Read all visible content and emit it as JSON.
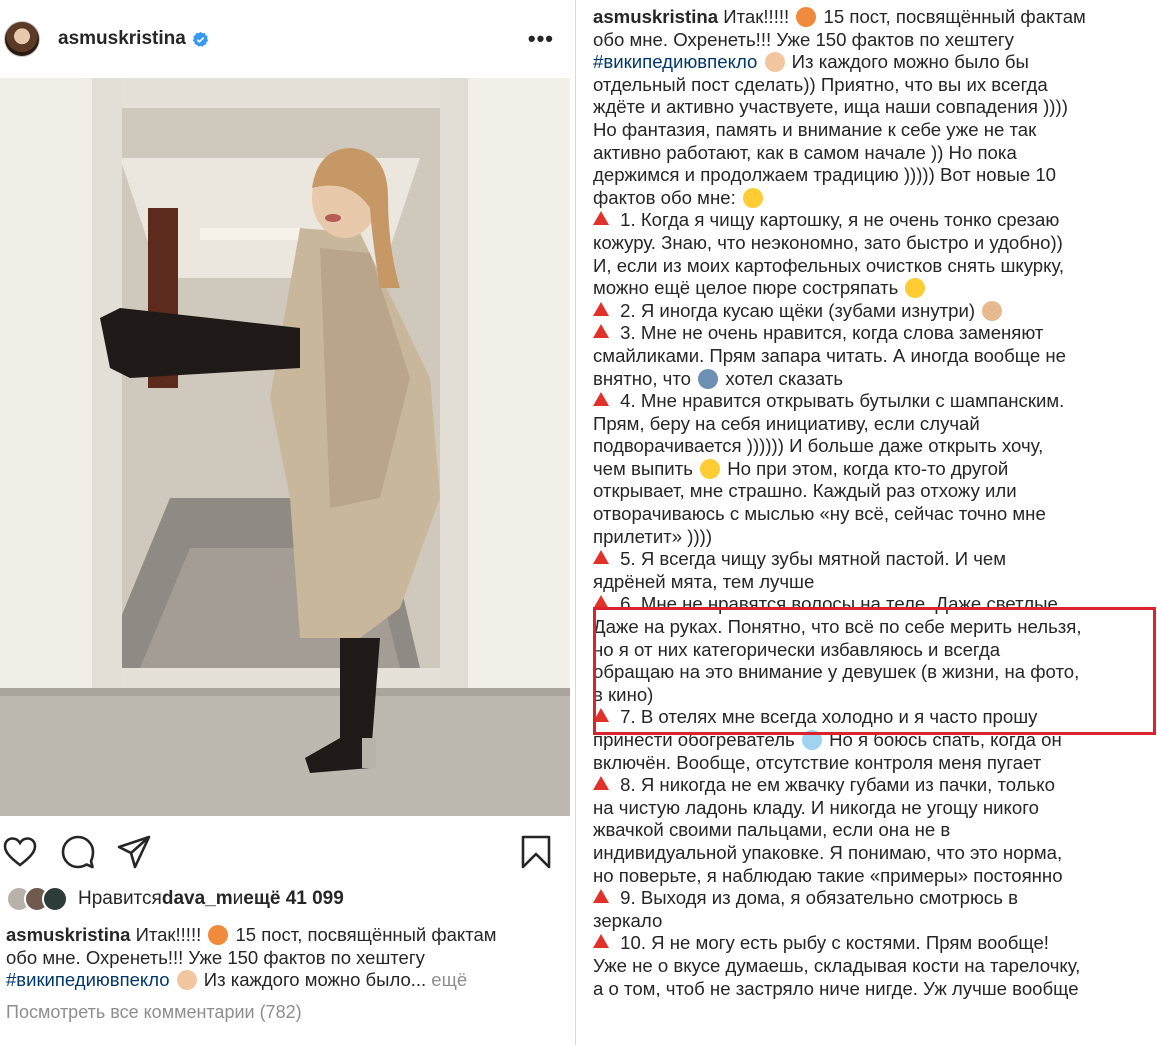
{
  "post": {
    "username": "asmuskristina",
    "more_label": "•••",
    "likes": {
      "prefix": "Нравится ",
      "user": "dava_m",
      "middle": " и ",
      "count": "ещё 41 099"
    },
    "caption_preview": {
      "username": "asmuskristina",
      "line1": " Итак!!!!! ",
      "line1b": " 15 пост, посвящённый фактам",
      "line2": "обо мне. Охренеть!!! Уже 150 фактов по хештегу",
      "hashtag": "#википедиювпекло",
      "line3": " Из каждого можно было...",
      "more": " ещё"
    },
    "view_comments": "Посмотреть все комментарии (782)"
  },
  "caption_full": {
    "username": "asmuskristina",
    "lines": [
      " Итак!!!!! [E1] 15 пост, посвящённый фактам",
      "обо мне. Охренеть!!! Уже 150 фактов по хештегу",
      "#википедиювпекло [E2] Из каждого можно было бы",
      "отдельный пост сделать)) Приятно, что вы их всегда",
      "ждёте и активно участвуете, ища наши совпадения ))))",
      "Но фантазия, память и внимание к себе уже не так",
      "активно работают, как в самом начале )) Но пока",
      "держимся и продолжаем традицию ))))) Вот новые 10",
      "фактов обо мне: [E3]",
      "[T] 1. Когда я чищу картошку, я не очень тонко срезаю",
      "кожуру. Знаю, что неэкономно, зато быстро и удобно))",
      "И, если из моих картофельных очистков снять шкурку,",
      "можно ещё целое пюре состряпать [E4]",
      "[T] 2. Я иногда кусаю щёки (зубами изнутри) [E5]",
      "[T] 3. Мне не очень нравится, когда слова заменяют",
      "смайликами. Прям запара читать. А иногда вообще не",
      "внятно, что [E6] хотел сказать",
      "[T] 4. Мне нравится открывать бутылки с шампанским.",
      "Прям, беру на себя инициативу, если случай",
      "подворачивается )))))) И больше даже открыть хочу,",
      "чем выпить [E4] Но при этом, когда кто-то другой",
      "открывает, мне страшно. Каждый раз отхожу или",
      "отворачиваюсь с мыслью «ну всё, сейчас точно мне",
      "прилетит» ))))",
      "[T] 5. Я всегда чищу зубы мятной пастой. И чем",
      "ядрёней мята, тем лучше",
      "[T] 6. Мне не нравятся волосы на теле. Даже светлые.",
      "Даже на руках. Понятно, что всё по себе мерить нельзя,",
      "но я от них категорически избавляюсь и всегда",
      "обращаю на это внимание у девушек (в жизни, на фото,",
      "в кино)",
      "[T] 7. В отелях мне всегда холодно и я часто прошу",
      "принести обогреватель [E7] Но я боюсь спать, когда он",
      "включён. Вообще, отсутствие контроля меня пугает",
      "[T] 8. Я никогда не ем жвачку губами из пачки, только",
      "на чистую ладонь кладу. И никогда не угощу никого",
      "жвачкой своими пальцами, если она не в",
      "индивидуальной упаковке. Я понимаю, что это норма,",
      "но поверьте, я наблюдаю такие «примеры» постоянно",
      "[T] 9. Выходя из дома, я обязательно смотрюсь в",
      "зеркало",
      "[T] 10. Я не могу есть рыбу с костями. Прям вообще!",
      "Уже не о вкусе думаешь, складывая кости на тарелочку,",
      "а о том, чтоб не застряло ниче нигде. Уж лучше вообще"
    ]
  },
  "emoji_colors": {
    "E1": "#f08a3c",
    "E2": "#f2c7a0",
    "E3": "#ffcc33",
    "E4": "#ffcc33",
    "E5": "#e8b98f",
    "E6": "#6d8fb3",
    "E7": "#9fd3f0"
  },
  "colors": {
    "accent_red": "#e0322a",
    "highlight": "#d9232d",
    "hashtag": "#00376b",
    "muted": "#8e8e8e",
    "verified": "#3897f0"
  }
}
